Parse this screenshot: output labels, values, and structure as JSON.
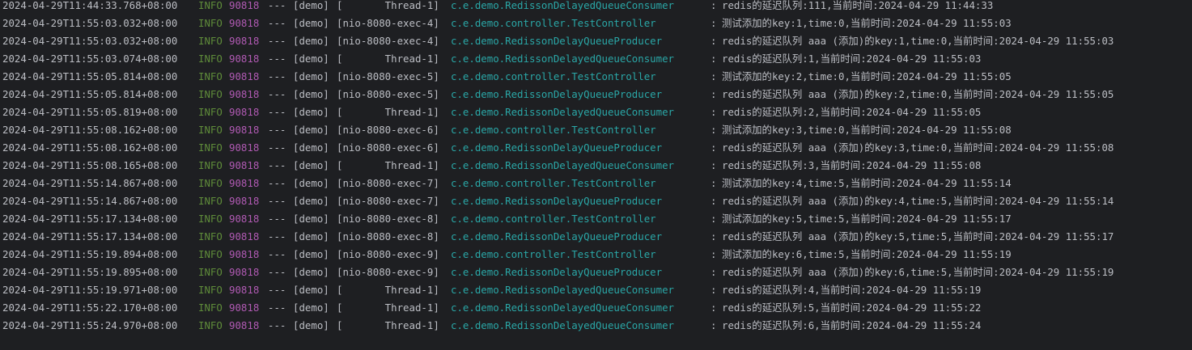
{
  "console": {
    "colors": {
      "background": "#1e1f22",
      "text": "#bcbec4",
      "level_info": "#5f8c3a",
      "pid": "#b05ab3",
      "logger": "#2aa7a7"
    },
    "lines": [
      {
        "ts": "2024-04-29T11:44:33.768+08:00",
        "level": "INFO",
        "pid": "90818",
        "sep": "---",
        "app": "[demo]",
        "thread": "[       Thread-1]",
        "logger": "c.e.demo.RedissonDelayedQueueConsumer",
        "colon": ":",
        "msg": "redis的延迟队列:111,当前时间:2024-04-29 11:44:33"
      },
      {
        "ts": "2024-04-29T11:55:03.032+08:00",
        "level": "INFO",
        "pid": "90818",
        "sep": "---",
        "app": "[demo]",
        "thread": "[nio-8080-exec-4]",
        "logger": "c.e.demo.controller.TestController",
        "colon": ":",
        "msg": "测试添加的key:1,time:0,当前时间:2024-04-29 11:55:03"
      },
      {
        "ts": "2024-04-29T11:55:03.032+08:00",
        "level": "INFO",
        "pid": "90818",
        "sep": "---",
        "app": "[demo]",
        "thread": "[nio-8080-exec-4]",
        "logger": "c.e.demo.RedissonDelayQueueProducer",
        "colon": ":",
        "msg": "redis的延迟队列 aaa (添加)的key:1,time:0,当前时间:2024-04-29 11:55:03"
      },
      {
        "ts": "2024-04-29T11:55:03.074+08:00",
        "level": "INFO",
        "pid": "90818",
        "sep": "---",
        "app": "[demo]",
        "thread": "[       Thread-1]",
        "logger": "c.e.demo.RedissonDelayedQueueConsumer",
        "colon": ":",
        "msg": "redis的延迟队列:1,当前时间:2024-04-29 11:55:03"
      },
      {
        "ts": "2024-04-29T11:55:05.814+08:00",
        "level": "INFO",
        "pid": "90818",
        "sep": "---",
        "app": "[demo]",
        "thread": "[nio-8080-exec-5]",
        "logger": "c.e.demo.controller.TestController",
        "colon": ":",
        "msg": "测试添加的key:2,time:0,当前时间:2024-04-29 11:55:05"
      },
      {
        "ts": "2024-04-29T11:55:05.814+08:00",
        "level": "INFO",
        "pid": "90818",
        "sep": "---",
        "app": "[demo]",
        "thread": "[nio-8080-exec-5]",
        "logger": "c.e.demo.RedissonDelayQueueProducer",
        "colon": ":",
        "msg": "redis的延迟队列 aaa (添加)的key:2,time:0,当前时间:2024-04-29 11:55:05"
      },
      {
        "ts": "2024-04-29T11:55:05.819+08:00",
        "level": "INFO",
        "pid": "90818",
        "sep": "---",
        "app": "[demo]",
        "thread": "[       Thread-1]",
        "logger": "c.e.demo.RedissonDelayedQueueConsumer",
        "colon": ":",
        "msg": "redis的延迟队列:2,当前时间:2024-04-29 11:55:05"
      },
      {
        "ts": "2024-04-29T11:55:08.162+08:00",
        "level": "INFO",
        "pid": "90818",
        "sep": "---",
        "app": "[demo]",
        "thread": "[nio-8080-exec-6]",
        "logger": "c.e.demo.controller.TestController",
        "colon": ":",
        "msg": "测试添加的key:3,time:0,当前时间:2024-04-29 11:55:08"
      },
      {
        "ts": "2024-04-29T11:55:08.162+08:00",
        "level": "INFO",
        "pid": "90818",
        "sep": "---",
        "app": "[demo]",
        "thread": "[nio-8080-exec-6]",
        "logger": "c.e.demo.RedissonDelayQueueProducer",
        "colon": ":",
        "msg": "redis的延迟队列 aaa (添加)的key:3,time:0,当前时间:2024-04-29 11:55:08"
      },
      {
        "ts": "2024-04-29T11:55:08.165+08:00",
        "level": "INFO",
        "pid": "90818",
        "sep": "---",
        "app": "[demo]",
        "thread": "[       Thread-1]",
        "logger": "c.e.demo.RedissonDelayedQueueConsumer",
        "colon": ":",
        "msg": "redis的延迟队列:3,当前时间:2024-04-29 11:55:08"
      },
      {
        "ts": "2024-04-29T11:55:14.867+08:00",
        "level": "INFO",
        "pid": "90818",
        "sep": "---",
        "app": "[demo]",
        "thread": "[nio-8080-exec-7]",
        "logger": "c.e.demo.controller.TestController",
        "colon": ":",
        "msg": "测试添加的key:4,time:5,当前时间:2024-04-29 11:55:14"
      },
      {
        "ts": "2024-04-29T11:55:14.867+08:00",
        "level": "INFO",
        "pid": "90818",
        "sep": "---",
        "app": "[demo]",
        "thread": "[nio-8080-exec-7]",
        "logger": "c.e.demo.RedissonDelayQueueProducer",
        "colon": ":",
        "msg": "redis的延迟队列 aaa (添加)的key:4,time:5,当前时间:2024-04-29 11:55:14"
      },
      {
        "ts": "2024-04-29T11:55:17.134+08:00",
        "level": "INFO",
        "pid": "90818",
        "sep": "---",
        "app": "[demo]",
        "thread": "[nio-8080-exec-8]",
        "logger": "c.e.demo.controller.TestController",
        "colon": ":",
        "msg": "测试添加的key:5,time:5,当前时间:2024-04-29 11:55:17"
      },
      {
        "ts": "2024-04-29T11:55:17.134+08:00",
        "level": "INFO",
        "pid": "90818",
        "sep": "---",
        "app": "[demo]",
        "thread": "[nio-8080-exec-8]",
        "logger": "c.e.demo.RedissonDelayQueueProducer",
        "colon": ":",
        "msg": "redis的延迟队列 aaa (添加)的key:5,time:5,当前时间:2024-04-29 11:55:17"
      },
      {
        "ts": "2024-04-29T11:55:19.894+08:00",
        "level": "INFO",
        "pid": "90818",
        "sep": "---",
        "app": "[demo]",
        "thread": "[nio-8080-exec-9]",
        "logger": "c.e.demo.controller.TestController",
        "colon": ":",
        "msg": "测试添加的key:6,time:5,当前时间:2024-04-29 11:55:19"
      },
      {
        "ts": "2024-04-29T11:55:19.895+08:00",
        "level": "INFO",
        "pid": "90818",
        "sep": "---",
        "app": "[demo]",
        "thread": "[nio-8080-exec-9]",
        "logger": "c.e.demo.RedissonDelayQueueProducer",
        "colon": ":",
        "msg": "redis的延迟队列 aaa (添加)的key:6,time:5,当前时间:2024-04-29 11:55:19"
      },
      {
        "ts": "2024-04-29T11:55:19.971+08:00",
        "level": "INFO",
        "pid": "90818",
        "sep": "---",
        "app": "[demo]",
        "thread": "[       Thread-1]",
        "logger": "c.e.demo.RedissonDelayedQueueConsumer",
        "colon": ":",
        "msg": "redis的延迟队列:4,当前时间:2024-04-29 11:55:19"
      },
      {
        "ts": "2024-04-29T11:55:22.170+08:00",
        "level": "INFO",
        "pid": "90818",
        "sep": "---",
        "app": "[demo]",
        "thread": "[       Thread-1]",
        "logger": "c.e.demo.RedissonDelayedQueueConsumer",
        "colon": ":",
        "msg": "redis的延迟队列:5,当前时间:2024-04-29 11:55:22"
      },
      {
        "ts": "2024-04-29T11:55:24.970+08:00",
        "level": "INFO",
        "pid": "90818",
        "sep": "---",
        "app": "[demo]",
        "thread": "[       Thread-1]",
        "logger": "c.e.demo.RedissonDelayedQueueConsumer",
        "colon": ":",
        "msg": "redis的延迟队列:6,当前时间:2024-04-29 11:55:24"
      }
    ]
  }
}
